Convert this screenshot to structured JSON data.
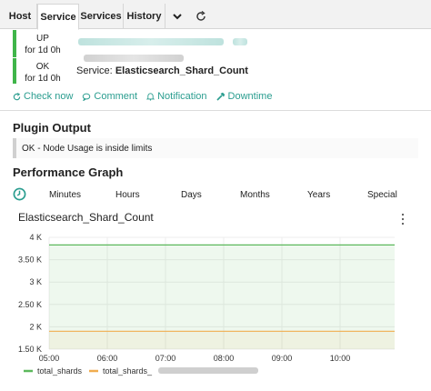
{
  "tabs": [
    {
      "label": "Host",
      "active": false
    },
    {
      "label": "Service",
      "active": true
    },
    {
      "label": "Services",
      "active": false
    },
    {
      "label": "History",
      "active": false
    }
  ],
  "host_status": {
    "state": "UP",
    "duration": "for 1d 0h"
  },
  "service_status": {
    "state": "OK",
    "duration": "for 1d 0h",
    "prefix": "Service:",
    "name": "Elasticsearch_Shard_Count"
  },
  "actions": [
    {
      "label": "Check now",
      "icon": "refresh-icon"
    },
    {
      "label": "Comment",
      "icon": "comment-icon"
    },
    {
      "label": "Notification",
      "icon": "bell-icon"
    },
    {
      "label": "Downtime",
      "icon": "hammer-icon"
    }
  ],
  "plugin_output": {
    "heading": "Plugin Output",
    "text": "OK - Node Usage is inside limits"
  },
  "performance": {
    "heading": "Performance Graph",
    "ranges": [
      "Minutes",
      "Hours",
      "Days",
      "Months",
      "Years",
      "Special"
    ]
  },
  "colors": {
    "accent": "#2a9d8f",
    "ok": "#3fb549",
    "series1": "#5cb85c",
    "series2": "#f0ad4e"
  },
  "chart_data": {
    "type": "area",
    "title": "Elasticsearch_Shard_Count",
    "x_ticks": [
      "05:00",
      "06:00",
      "07:00",
      "08:00",
      "09:00",
      "10:00"
    ],
    "y_ticks": [
      "1.50 K",
      "2 K",
      "2.50 K",
      "3 K",
      "3.50 K",
      "4 K"
    ],
    "ylim": [
      1500,
      4000
    ],
    "series": [
      {
        "name": "total_shards",
        "color": "#5cb85c",
        "values": [
          3830,
          3830,
          3830,
          3830,
          3830,
          3830,
          3830
        ]
      },
      {
        "name": "total_shards_",
        "color": "#f0ad4e",
        "values": [
          1900,
          1900,
          1900,
          1900,
          1900,
          1900,
          1900
        ]
      }
    ],
    "grid": true,
    "legend": "bottom-left"
  }
}
